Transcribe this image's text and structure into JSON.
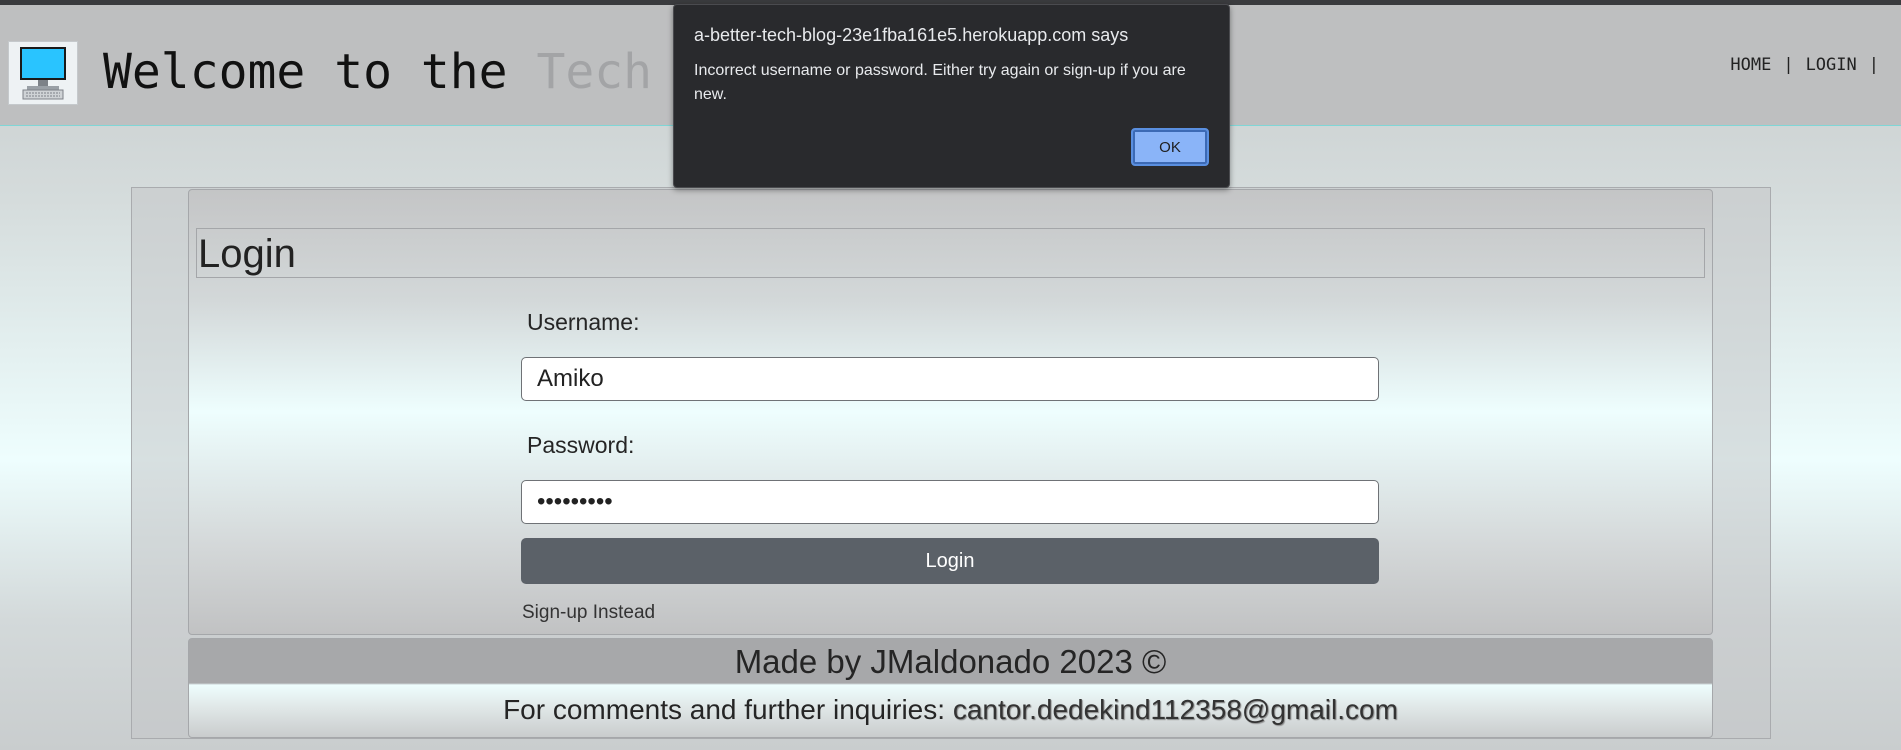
{
  "header": {
    "welcome_prefix": "Welcome to the ",
    "welcome_faded": "Tech",
    "nav": {
      "home": "HOME",
      "separator": "|",
      "login": "LOGIN"
    }
  },
  "login": {
    "title": "Login",
    "username_label": "Username:",
    "username_value": "Amiko",
    "password_label": "Password:",
    "password_value": "123456789",
    "button_label": "Login",
    "signup_link": "Sign-up Instead"
  },
  "footer": {
    "made_by": "Made by JMaldonado 2023 ©",
    "contact_prefix": "For comments and further inquiries: ",
    "contact_email": "cantor.dedekind112358@gmail.com"
  },
  "dialog": {
    "title": "a-better-tech-blog-23e1fba161e5.herokuapp.com says",
    "message": "Incorrect username or password. Either try again or sign-up if you are new.",
    "ok_label": "OK"
  },
  "colors": {
    "monitor_screen": "#29c4ff",
    "login_button": "#5b6168",
    "dialog_bg": "#292a2d",
    "dialog_ok": "#8ab4f8"
  },
  "icons": {
    "logo": "computer-monitor-icon"
  }
}
